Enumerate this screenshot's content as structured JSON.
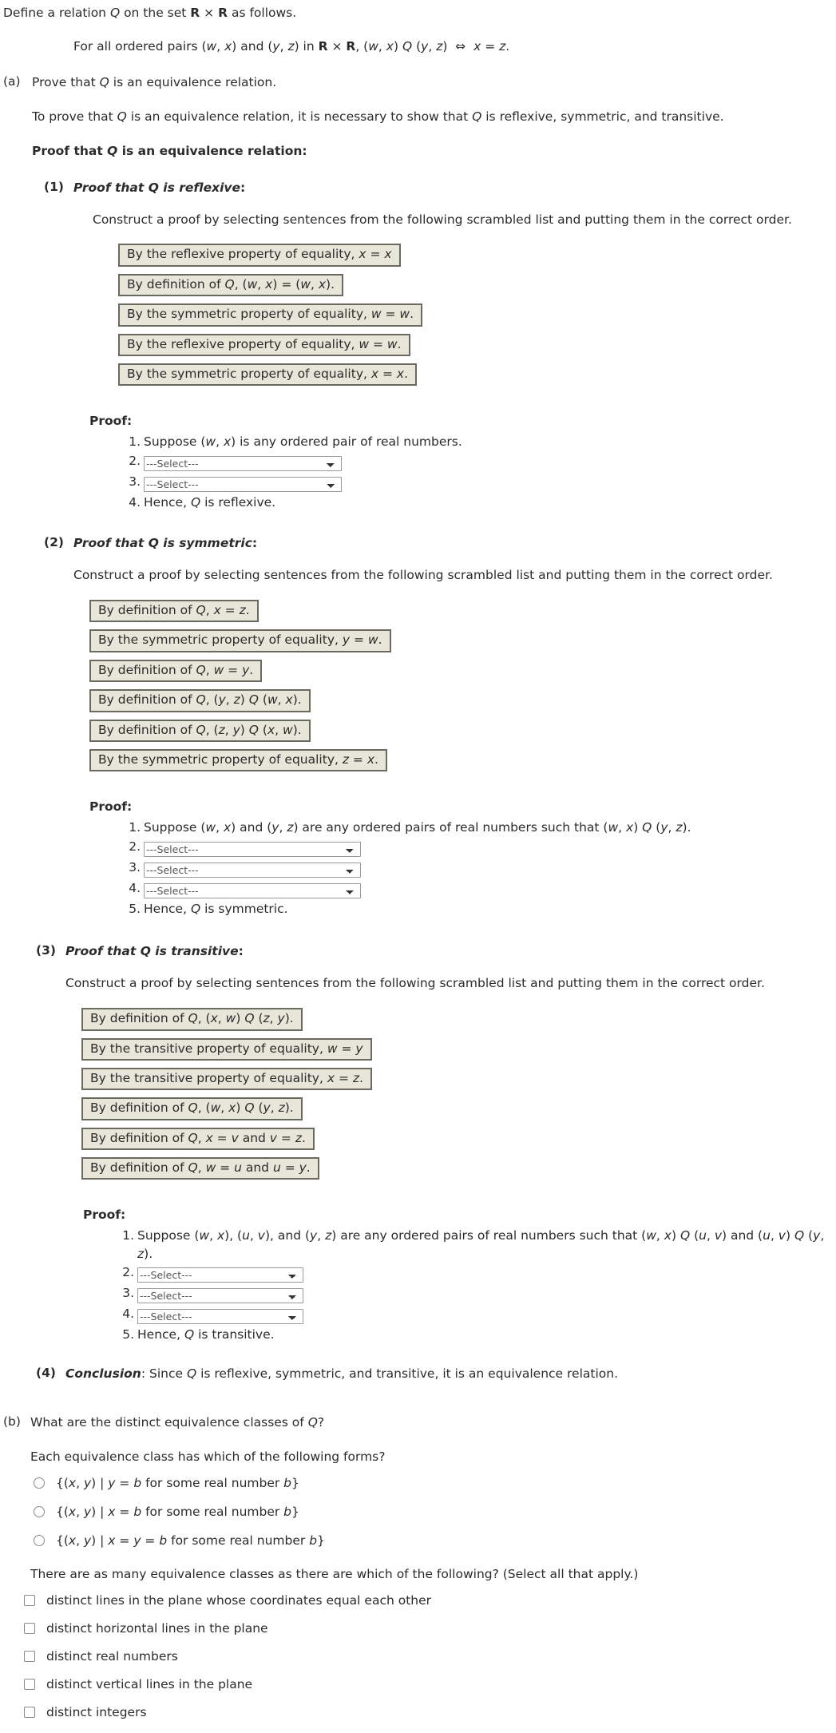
{
  "intro": {
    "definition": "Define a relation Q on the set R × R as follows.",
    "quantifier": "For all ordered pairs (w, x) and (y, z) in R × R, (w, x) Q (y, z)  ⇔  x = z."
  },
  "part_a": {
    "label": "(a)",
    "prompt": "Prove that Q is an equivalence relation.",
    "necessary": "To prove that Q is an equivalence relation, it is necessary to show that Q is reflexive, symmetric, and transitive.",
    "heading": "Proof that Q is an equivalence relation:",
    "construct_text": "Construct a proof by selecting sentences from the following scrambled list and putting them in the correct order.",
    "proof_label": "Proof:",
    "select_placeholder": "---Select---",
    "subproofs": [
      {
        "num": "(1)",
        "title": "Proof that Q is reflexive:",
        "scrambled": [
          "By the reflexive property of equality, x = x",
          "By definition of Q, (w, x) = (w, x).",
          "By the symmetric property of equality, w = w.",
          "By the reflexive property of equality, w = w.",
          "By the symmetric property of equality, x = x."
        ],
        "steps": [
          {
            "type": "text",
            "text": "Suppose (w, x) is any ordered pair of real numbers."
          },
          {
            "type": "select",
            "value": "---Select---"
          },
          {
            "type": "select",
            "value": "---Select---"
          },
          {
            "type": "text",
            "text": "Hence, Q is reflexive."
          }
        ]
      },
      {
        "num": "(2)",
        "title": "Proof that Q is symmetric:",
        "scrambled": [
          "By definition of Q, x = z.",
          "By the symmetric property of equality, y = w.",
          "By definition of Q, w = y.",
          "By definition of Q, (y, z) Q (w, x).",
          "By definition of Q, (z, y) Q (x, w).",
          "By the symmetric property of equality, z = x."
        ],
        "steps": [
          {
            "type": "text",
            "text": "Suppose (w, x) and (y, z) are any ordered pairs of real numbers such that (w, x) Q (y, z)."
          },
          {
            "type": "select",
            "value": "---Select---"
          },
          {
            "type": "select",
            "value": "---Select---"
          },
          {
            "type": "select",
            "value": "---Select---"
          },
          {
            "type": "text",
            "text": "Hence, Q is symmetric."
          }
        ]
      },
      {
        "num": "(3)",
        "title": "Proof that Q is transitive:",
        "scrambled": [
          "By definition of Q, (x, w) Q (z, y).",
          "By the transitive property of equality, w = y",
          "By the transitive property of equality, x = z.",
          "By definition of Q, (w, x) Q (y, z).",
          "By definition of Q, x = v and v = z.",
          "By definition of Q, w = u and u = y."
        ],
        "steps": [
          {
            "type": "text",
            "text": "Suppose (w, x), (u, v), and (y, z) are any ordered pairs of real numbers such that (w, x) Q (u, v) and (u, v) Q (y, z)."
          },
          {
            "type": "select",
            "value": "---Select---"
          },
          {
            "type": "select",
            "value": "---Select---"
          },
          {
            "type": "select",
            "value": "---Select---"
          },
          {
            "type": "text",
            "text": "Hence, Q is transitive."
          }
        ]
      }
    ],
    "conclusion": {
      "num": "(4)",
      "label": "Conclusion",
      "text": ": Since Q is reflexive, symmetric, and transitive, it is an equivalence relation."
    }
  },
  "part_b": {
    "label": "(b)",
    "prompt": "What are the distinct equivalence classes of Q?",
    "forms_question": "Each equivalence class has which of the following forms?",
    "radio_options": [
      "{(x, y) | y = b for some real number b}",
      "{(x, y) | x = b for some real number b}",
      "{(x, y) | x = y = b for some real number b}"
    ],
    "count_question": "There are as many equivalence classes as there are which of the following? (Select all that apply.)",
    "checkbox_options": [
      "distinct lines in the plane whose coordinates equal each other",
      "distinct horizontal lines in the plane",
      "distinct real numbers",
      "distinct vertical lines in the plane",
      "distinct integers"
    ]
  }
}
